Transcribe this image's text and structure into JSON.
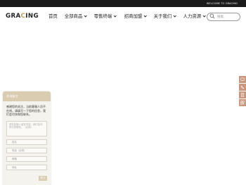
{
  "topbar": {
    "welcome": "WELCOME TO GRACING"
  },
  "brand": {
    "logo_prefix": "GRA",
    "logo_accent": "C",
    "logo_suffix": "ING",
    "accent_color": "#c8a24a"
  },
  "nav": {
    "items": [
      {
        "label": "首页",
        "dropdown": false
      },
      {
        "label": "全部商品",
        "dropdown": true
      },
      {
        "label": "零售终端",
        "dropdown": true
      },
      {
        "label": "招商加盟",
        "dropdown": true
      },
      {
        "label": "关于我们",
        "dropdown": true
      },
      {
        "label": "人力资源",
        "dropdown": true
      }
    ]
  },
  "search": {
    "placeholder": "搜索"
  },
  "side_tools": [
    {
      "icon": "message-icon"
    },
    {
      "icon": "phone-icon"
    },
    {
      "icon": "document-icon"
    },
    {
      "icon": "qrcode-icon"
    }
  ],
  "chat": {
    "title": "咨询留言",
    "intro": "感谢您的关注，当前客服人员不在线，请填写一下您的信息，我们会尽快和您联系。",
    "textarea_placeholder": "请在此输入留言内容，我们会尽快与您联系。（必填）",
    "fields": [
      {
        "placeholder": "姓名",
        "required": false
      },
      {
        "placeholder": "电话（必填）",
        "required": true
      },
      {
        "placeholder": "邮箱",
        "required": false
      },
      {
        "placeholder": "地址",
        "required": false
      }
    ],
    "submit_label": "提交"
  },
  "colors": {
    "topbar_bg": "#1a1a1a",
    "chat_header_bg": "#d9ccb0",
    "side_tool_bg": "#c9967e"
  }
}
